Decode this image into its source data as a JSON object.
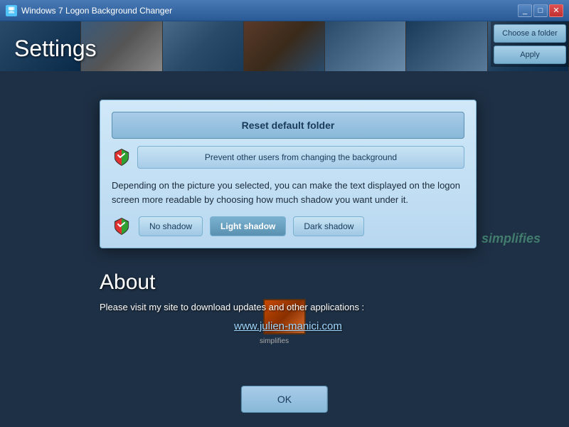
{
  "titlebar": {
    "title": "Windows 7 Logon Background Changer",
    "icon": "🖥",
    "buttons": [
      "_",
      "□",
      "✕"
    ]
  },
  "sidebar": {
    "choose_folder": "Choose a folder",
    "apply": "Apply",
    "settings": "Settings"
  },
  "settings": {
    "heading": "Settings",
    "reset_btn": "Reset default folder",
    "prevent_btn": "Prevent other users from changing the background",
    "shadow_description": "Depending on the picture you selected, you can make the text displayed on the logon screen more readable by choosing how much shadow you want under it.",
    "no_shadow": "No shadow",
    "light_shadow": "Light shadow",
    "dark_shadow": "Dark shadow"
  },
  "about": {
    "heading": "About",
    "text": "Please visit my site to download updates and other applications :",
    "link": "www.julien-manici.com"
  },
  "ok_button": "OK",
  "watermark": "simplifies",
  "thumb_label": "simplifies"
}
